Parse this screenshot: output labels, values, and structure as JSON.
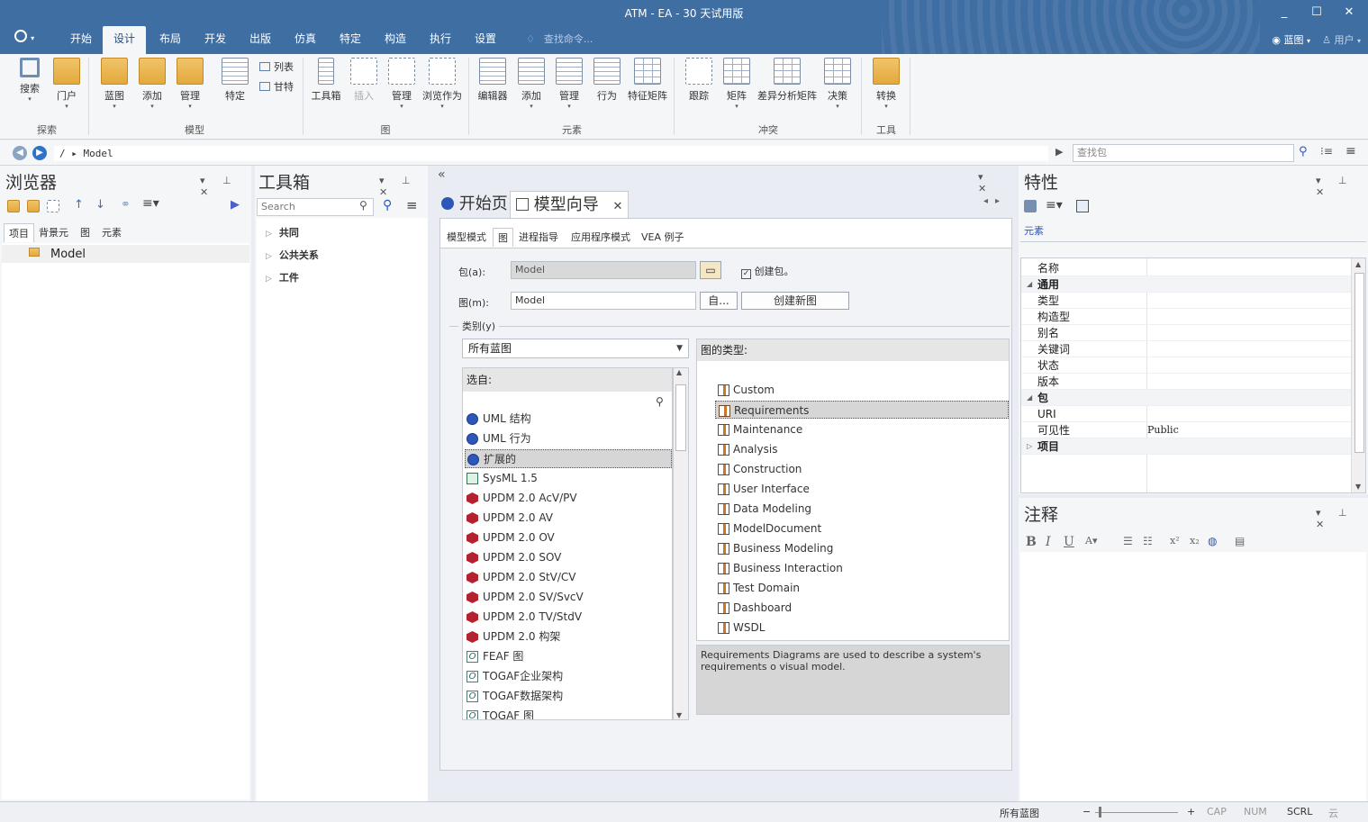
{
  "window": {
    "title": "ATM - EA - 30 天试用版",
    "min": "_",
    "max": "☐",
    "close": "✕"
  },
  "menu": {
    "tabs": [
      "开始",
      "设计",
      "布局",
      "开发",
      "出版",
      "仿真",
      "特定",
      "构造",
      "执行",
      "设置"
    ],
    "active": "设计",
    "search_placeholder": "查找命令...",
    "view_label": "蓝图",
    "user_label": "用户"
  },
  "ribbon": {
    "explore": {
      "group": "探索",
      "search": "搜索",
      "portal": "门户"
    },
    "model": {
      "group": "模型",
      "blueprint": "蓝图",
      "add": "添加",
      "manage": "管理",
      "specific": "特定",
      "list": "列表",
      "gantt": "甘特"
    },
    "diagram": {
      "group": "图",
      "toolbox": "工具箱",
      "insert": "插入",
      "manage": "管理",
      "browse_as": "浏览作为"
    },
    "element": {
      "group": "元素",
      "editor": "编辑器",
      "add": "添加",
      "manage": "管理",
      "behavior": "行为",
      "feature_matrix": "特征矩阵"
    },
    "conflict": {
      "group": "冲突",
      "trace": "跟踪",
      "matrix": "矩阵",
      "gap_matrix": "差异分析矩阵",
      "decision": "决策"
    },
    "tools": {
      "group": "工具",
      "convert": "转换"
    }
  },
  "addressbar": {
    "path": "/   ▸ Model",
    "search_placeholder": "查找包"
  },
  "browser": {
    "title": "浏览器",
    "tabs": [
      "项目",
      "背景元",
      "图",
      "元素"
    ],
    "tree_root": "Model"
  },
  "toolbox": {
    "title": "工具箱",
    "search_placeholder": "Search",
    "sections": [
      "共同",
      "公共关系",
      "工件"
    ]
  },
  "center": {
    "tab_start": "开始页",
    "tab_wizard": "模型向导",
    "wizard_tabs": [
      "模型模式",
      "图",
      "进程指导",
      "应用程序模式",
      "VEA 例子"
    ],
    "package_label": "包(a):",
    "package_value": "Model",
    "create_package_label": "创建包。",
    "diagram_label": "图(m):",
    "diagram_value": "Model",
    "auto_button": "自...",
    "create_diagram_button": "创建新图",
    "category_label": "类别(y)",
    "category_value": "所有蓝图",
    "from_header": "选自:",
    "from_items": [
      {
        "label": "UML 结构",
        "icon": "uml"
      },
      {
        "label": "UML 行为",
        "icon": "uml"
      },
      {
        "label": "扩展的",
        "icon": "uml"
      },
      {
        "label": "SysML 1.5",
        "icon": "sysml"
      },
      {
        "label": "UPDM 2.0 AcV/PV",
        "icon": "updm"
      },
      {
        "label": "UPDM 2.0 AV",
        "icon": "updm"
      },
      {
        "label": "UPDM 2.0 OV",
        "icon": "updm"
      },
      {
        "label": "UPDM 2.0 SOV",
        "icon": "updm"
      },
      {
        "label": "UPDM 2.0 StV/CV",
        "icon": "updm"
      },
      {
        "label": "UPDM 2.0 SV/SvcV",
        "icon": "updm"
      },
      {
        "label": "UPDM 2.0 TV/StdV",
        "icon": "updm"
      },
      {
        "label": "UPDM 2.0 构架",
        "icon": "updm"
      },
      {
        "label": "FEAF 图",
        "icon": "fw"
      },
      {
        "label": "TOGAF企业架构",
        "icon": "fw"
      },
      {
        "label": "TOGAF数据架构",
        "icon": "fw"
      },
      {
        "label": "TOGAF 图",
        "icon": "fw"
      }
    ],
    "from_selected": "扩展的",
    "types_header": "图的类型:",
    "types": [
      "Custom",
      "Requirements",
      "Maintenance",
      "Analysis",
      "Construction",
      "User Interface",
      "Data Modeling",
      "ModelDocument",
      "Business Modeling",
      "Business Interaction",
      "Test Domain",
      "Dashboard",
      "WSDL"
    ],
    "type_selected": "Requirements",
    "type_description": "Requirements Diagrams are used to describe a system's requirements o visual model."
  },
  "properties": {
    "title": "特性",
    "tab": "元素",
    "rows": [
      {
        "key": "名称",
        "value": "",
        "kind": "row"
      },
      {
        "key": "通用",
        "value": "",
        "kind": "group"
      },
      {
        "key": "类型",
        "value": "",
        "kind": "row"
      },
      {
        "key": "构造型",
        "value": "",
        "kind": "row"
      },
      {
        "key": "别名",
        "value": "",
        "kind": "row"
      },
      {
        "key": "关键词",
        "value": "",
        "kind": "row"
      },
      {
        "key": "状态",
        "value": "",
        "kind": "row"
      },
      {
        "key": "版本",
        "value": "",
        "kind": "row"
      },
      {
        "key": "包",
        "value": "",
        "kind": "group"
      },
      {
        "key": "URI",
        "value": "",
        "kind": "row"
      },
      {
        "key": "可见性",
        "value": "Public",
        "kind": "row"
      },
      {
        "key": "项目",
        "value": "",
        "kind": "group-collapsed"
      }
    ]
  },
  "notes": {
    "title": "注释",
    "format_buttons": [
      "B",
      "I",
      "U"
    ]
  },
  "statusbar": {
    "perspective": "所有蓝图",
    "minus": "−",
    "plus": "+",
    "cap": "CAP",
    "num": "NUM",
    "scrl": "SCRL",
    "cloud": "云"
  },
  "colors": {
    "titlebar": "#3f6ea3",
    "ribbon": "#f5f6f8",
    "accent": "#2e56b8",
    "selection": "#d6d6d6"
  }
}
